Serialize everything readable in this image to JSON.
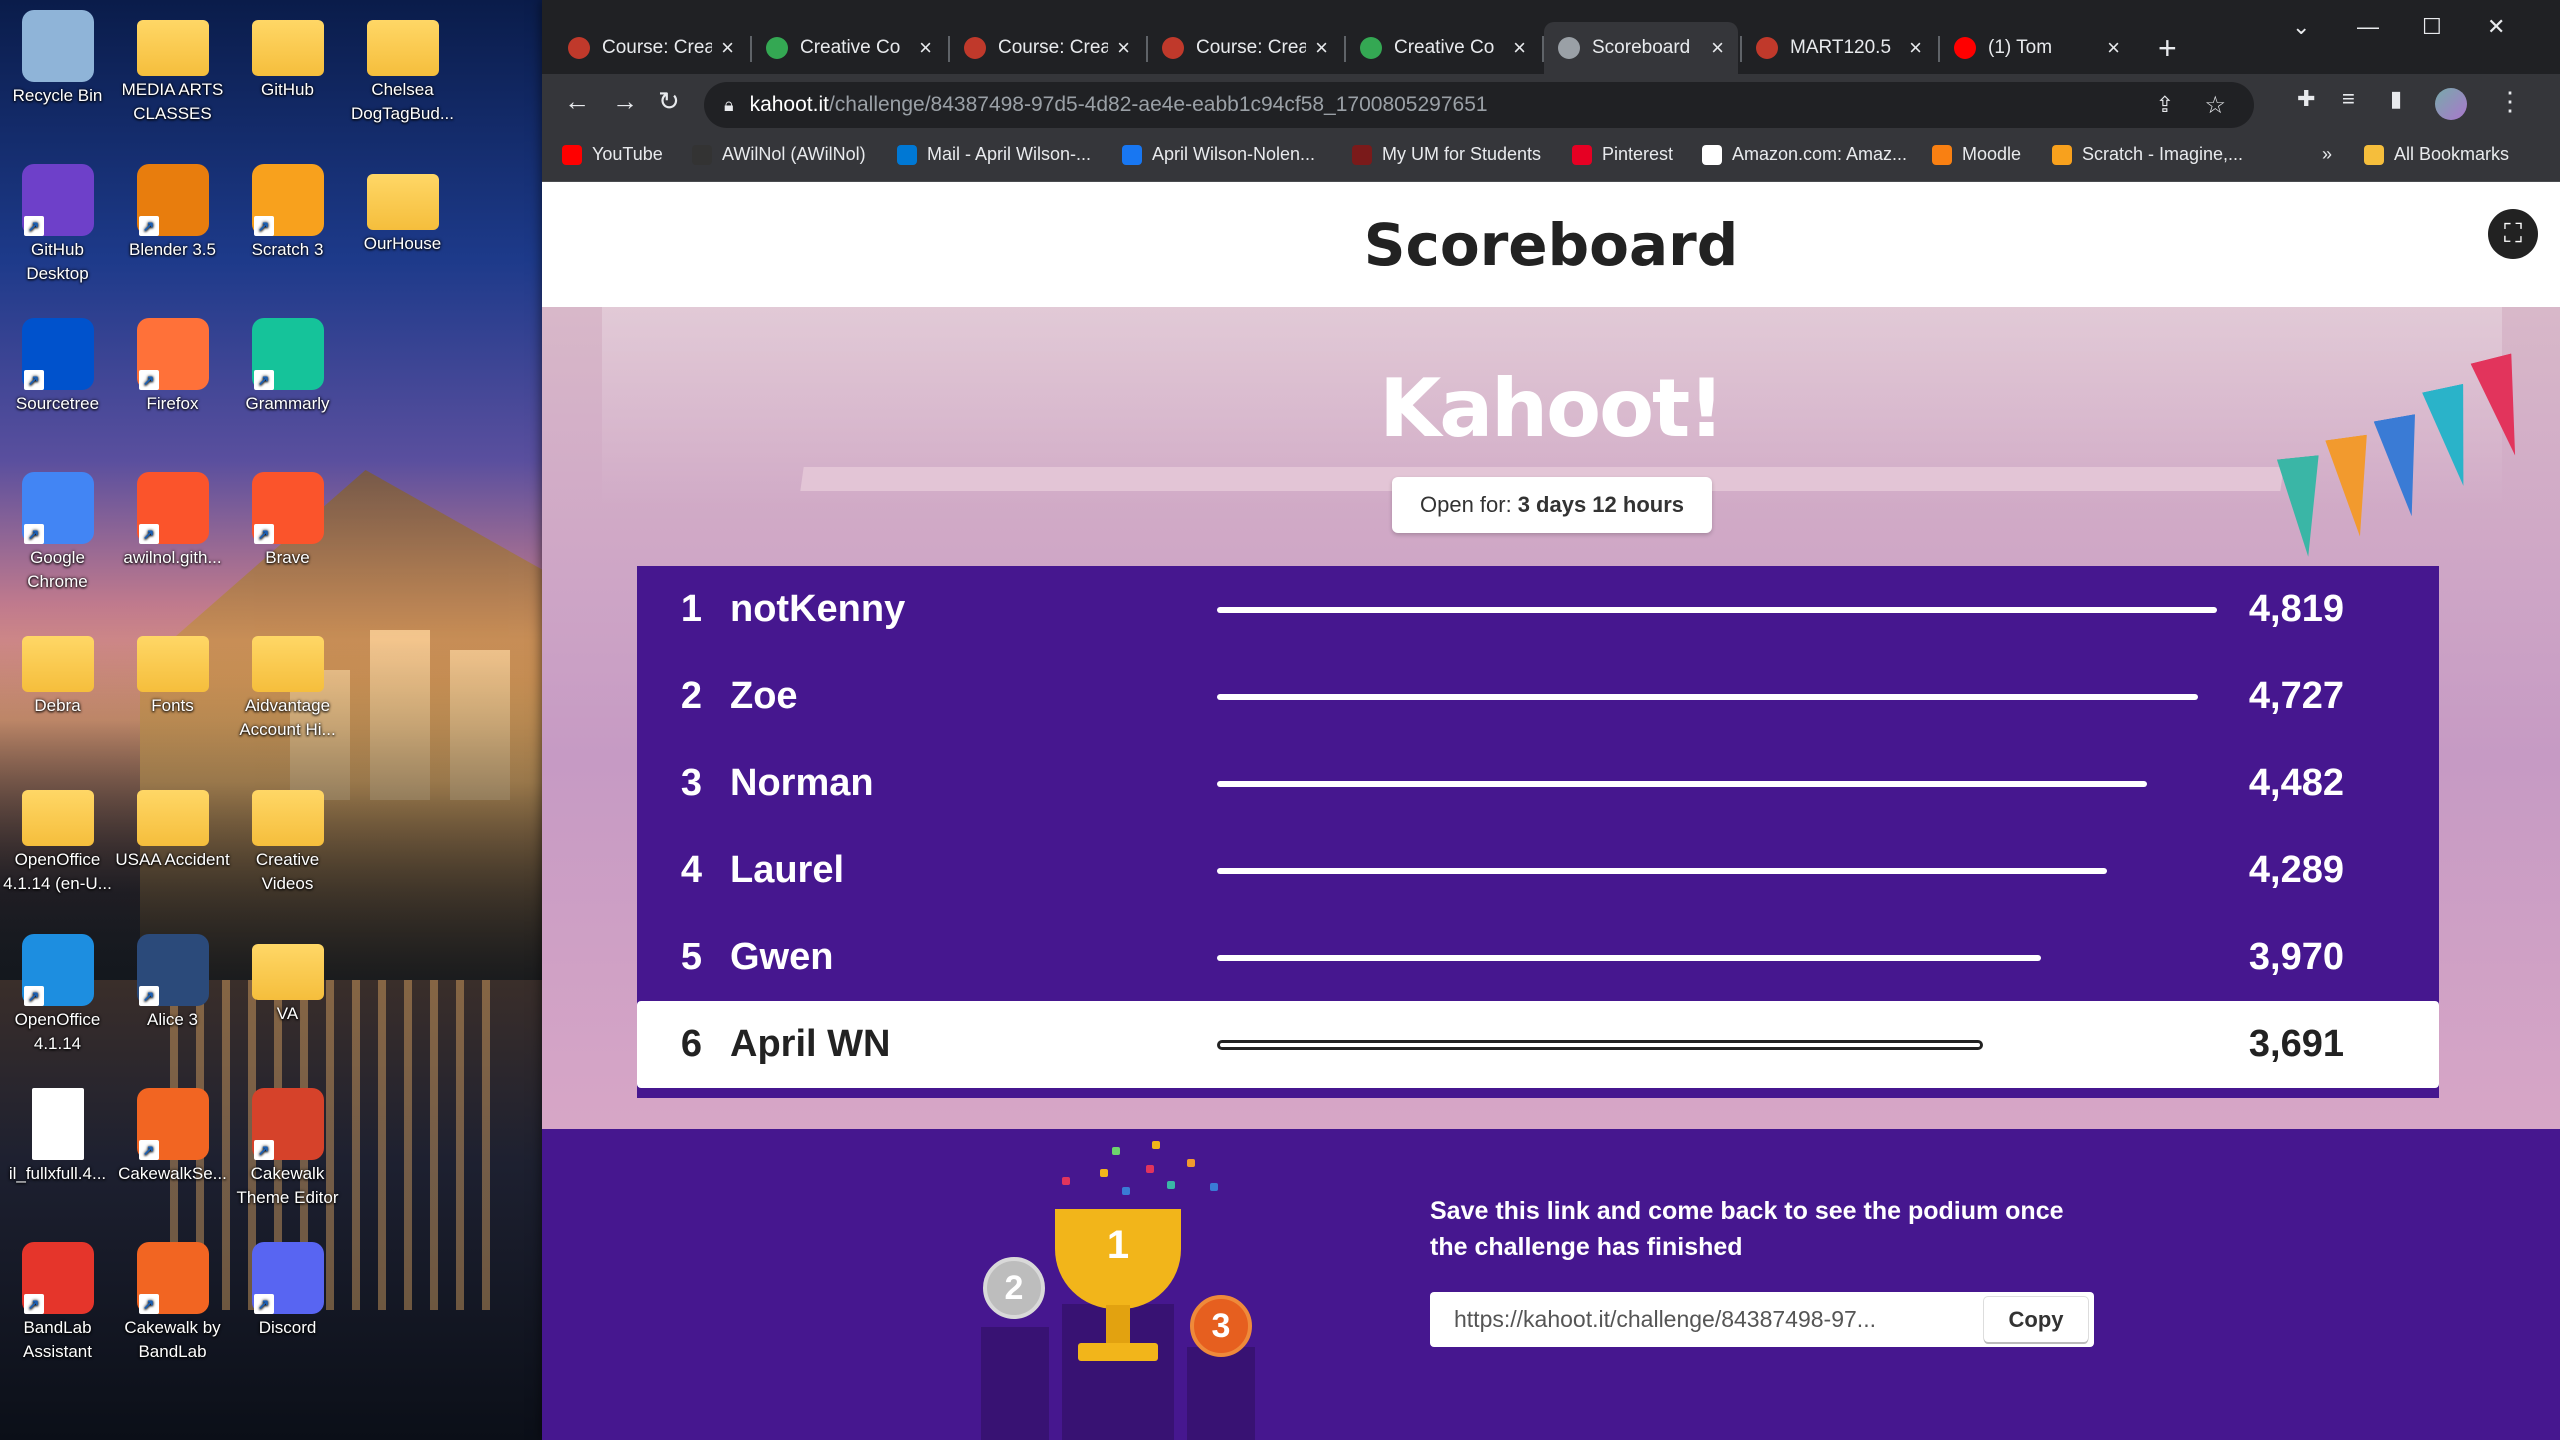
{
  "desktop": {
    "icons": [
      {
        "label": "Recycle Bin",
        "icon": "recycle-bin-icon",
        "color": "#8fb4d8"
      },
      {
        "label": "MEDIA ARTS CLASSES",
        "icon": "folder-icon",
        "color": "#f5be3c"
      },
      {
        "label": "GitHub",
        "icon": "folder-icon",
        "color": "#f5be3c"
      },
      {
        "label": "Chelsea DogTagBud...",
        "icon": "folder-icon",
        "color": "#f5be3c"
      },
      {
        "label": "GitHub Desktop",
        "icon": "github-desktop-icon",
        "color": "#6e40c9"
      },
      {
        "label": "Blender 3.5",
        "icon": "blender-icon",
        "color": "#e87d0d"
      },
      {
        "label": "Scratch 3",
        "icon": "scratch-icon",
        "color": "#f8a11d"
      },
      {
        "label": "OurHouse",
        "icon": "folder-icon",
        "color": "#f5be3c"
      },
      {
        "label": "Sourcetree",
        "icon": "sourcetree-icon",
        "color": "#0052cc"
      },
      {
        "label": "Firefox",
        "icon": "firefox-icon",
        "color": "#ff7139"
      },
      {
        "label": "Grammarly",
        "icon": "grammarly-icon",
        "color": "#15c39a"
      },
      {
        "label": "Google Chrome",
        "icon": "chrome-icon",
        "color": "#4285f4"
      },
      {
        "label": "awilnol.gith...",
        "icon": "brave-icon",
        "color": "#fb542b"
      },
      {
        "label": "Brave",
        "icon": "brave-icon",
        "color": "#fb542b"
      },
      {
        "label": "Debra",
        "icon": "folder-icon",
        "color": "#f5be3c"
      },
      {
        "label": "Fonts",
        "icon": "folder-icon",
        "color": "#f5be3c"
      },
      {
        "label": "Aidvantage Account Hi...",
        "icon": "folder-icon",
        "color": "#f5be3c"
      },
      {
        "label": "OpenOffice 4.1.14 (en-U...",
        "icon": "folder-icon",
        "color": "#f5be3c"
      },
      {
        "label": "USAA Accident",
        "icon": "folder-icon",
        "color": "#f5be3c"
      },
      {
        "label": "Creative Videos",
        "icon": "folder-icon",
        "color": "#f5be3c"
      },
      {
        "label": "OpenOffice 4.1.14",
        "icon": "openoffice-icon",
        "color": "#1d8ee0"
      },
      {
        "label": "Alice 3",
        "icon": "alice-icon",
        "color": "#2b4a7a"
      },
      {
        "label": "VA",
        "icon": "folder-icon",
        "color": "#f5be3c"
      },
      {
        "label": "il_fullxfull.4...",
        "icon": "file-icon",
        "color": "#ffffff"
      },
      {
        "label": "CakewalkSe...",
        "icon": "cakewalk-icon",
        "color": "#f26522"
      },
      {
        "label": "Cakewalk Theme Editor",
        "icon": "cakewalk-theme-icon",
        "color": "#d6422a"
      },
      {
        "label": "BandLab Assistant",
        "icon": "bandlab-icon",
        "color": "#e5352b"
      },
      {
        "label": "Cakewalk by BandLab",
        "icon": "cakewalk-icon",
        "color": "#f26522"
      },
      {
        "label": "Discord",
        "icon": "discord-icon",
        "color": "#5865f2"
      }
    ]
  },
  "browser": {
    "tabs": [
      {
        "title": "Course: Crea",
        "icon": "moodle-icon",
        "color": "#c0392b"
      },
      {
        "title": "Creative Co",
        "icon": "drive-icon",
        "color": "#34a853"
      },
      {
        "title": "Course: Crea",
        "icon": "moodle-icon",
        "color": "#c0392b"
      },
      {
        "title": "Course: Crea",
        "icon": "moodle-icon",
        "color": "#c0392b"
      },
      {
        "title": "Creative Co",
        "icon": "drive-icon",
        "color": "#34a853"
      },
      {
        "title": "Scoreboard",
        "icon": "globe-icon",
        "color": "#9aa0a6"
      },
      {
        "title": "MART120.5",
        "icon": "moodle-icon",
        "color": "#c0392b"
      },
      {
        "title": "(1) Tom",
        "icon": "youtube-icon",
        "color": "#ff0000"
      }
    ],
    "new_tab": "+",
    "url_host": "kahoot.it",
    "url_path": "/challenge/84387498-97d5-4d82-ae4e-eabb1c94cf58_1700805297651",
    "bookmarks": [
      {
        "label": "YouTube",
        "icon": "youtube-icon",
        "color": "#ff0000"
      },
      {
        "label": "AWilNol (AWilNol)",
        "icon": "github-icon",
        "color": "#333333"
      },
      {
        "label": "Mail - April Wilson-...",
        "icon": "outlook-icon",
        "color": "#0078d4"
      },
      {
        "label": "April Wilson-Nolen...",
        "icon": "facebook-icon",
        "color": "#1877f2"
      },
      {
        "label": "My UM for Students",
        "icon": "um-icon",
        "color": "#7a1a1a"
      },
      {
        "label": "Pinterest",
        "icon": "pinterest-icon",
        "color": "#e60023"
      },
      {
        "label": "Amazon.com: Amaz...",
        "icon": "amazon-icon",
        "color": "#ffffff"
      },
      {
        "label": "Moodle",
        "icon": "moodle-icon",
        "color": "#f98012"
      },
      {
        "label": "Scratch - Imagine,...",
        "icon": "scratch-icon",
        "color": "#f8a11d"
      }
    ],
    "more_bookmarks": "»",
    "all_bookmarks": "All Bookmarks"
  },
  "page": {
    "title": "Scoreboard",
    "brand": "Kahoot!",
    "open_for_label": "Open for:",
    "open_for_value": "3 days 12 hours",
    "leaderboard": [
      {
        "rank": "1",
        "name": "notKenny",
        "score": "4,819",
        "points": 4819
      },
      {
        "rank": "2",
        "name": "Zoe",
        "score": "4,727",
        "points": 4727
      },
      {
        "rank": "3",
        "name": "Norman",
        "score": "4,482",
        "points": 4482
      },
      {
        "rank": "4",
        "name": "Laurel",
        "score": "4,289",
        "points": 4289
      },
      {
        "rank": "5",
        "name": "Gwen",
        "score": "3,970",
        "points": 3970
      },
      {
        "rank": "6",
        "name": "April WN",
        "score": "3,691",
        "points": 3691,
        "is_current_player": true
      }
    ],
    "podium_message": "Save this link and come back to see the podium once the challenge has finished",
    "share_link": "https://kahoot.it/challenge/84387498-97...",
    "copy_label": "Copy",
    "podium_places": [
      "1",
      "2",
      "3"
    ],
    "colors": {
      "brand_purple": "#46178f",
      "gold": "#f2b51a",
      "silver": "#bdbdbd",
      "bronze": "#e65f1f"
    }
  }
}
